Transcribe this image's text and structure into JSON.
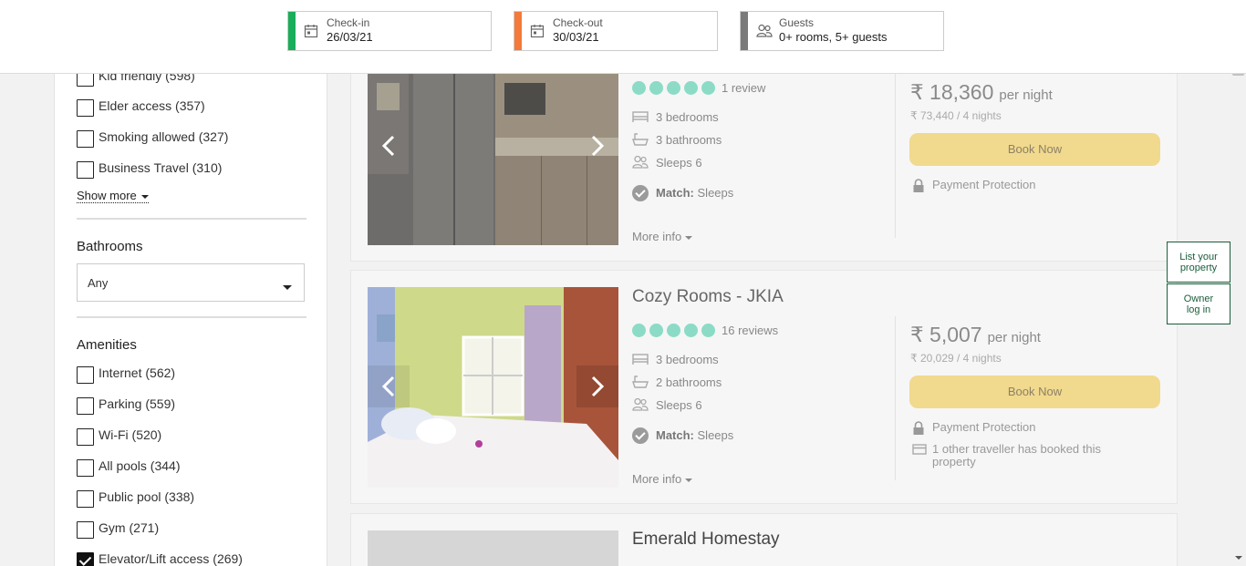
{
  "header": {
    "checkin": {
      "label": "Check-in",
      "value": "26/03/21",
      "color": "#1aae5a"
    },
    "checkout": {
      "label": "Check-out",
      "value": "30/03/21",
      "color": "#f47a3a"
    },
    "guests": {
      "label": "Guests",
      "value": "0+ rooms, 5+ guests",
      "color": "#7a7a7a"
    }
  },
  "sidebar": {
    "suitability": [
      {
        "label": "Kid friendly (598)",
        "checked": false
      },
      {
        "label": "Elder access (357)",
        "checked": false
      },
      {
        "label": "Smoking allowed (327)",
        "checked": false
      },
      {
        "label": "Business Travel (310)",
        "checked": false
      }
    ],
    "show_more": "Show more",
    "bathrooms_title": "Bathrooms",
    "bathrooms_value": "Any",
    "amenities_title": "Amenities",
    "amenities": [
      {
        "label": "Internet (562)",
        "checked": false
      },
      {
        "label": "Parking (559)",
        "checked": false
      },
      {
        "label": "Wi-Fi (520)",
        "checked": false
      },
      {
        "label": "All pools (344)",
        "checked": false
      },
      {
        "label": "Public pool (338)",
        "checked": false
      },
      {
        "label": "Gym (271)",
        "checked": false
      },
      {
        "label": "Elevator/Lift access (269)",
        "checked": true
      }
    ]
  },
  "listings": [
    {
      "title": "",
      "rating": 5,
      "reviews": "1 review",
      "bedrooms": "3 bedrooms",
      "bathrooms": "3 bathrooms",
      "sleeps": "Sleeps 6",
      "match_label": "Match:",
      "match_value": "Sleeps",
      "more_info": "More info",
      "price": "₹ 18,360",
      "per_night": "per night",
      "total": "₹ 73,440 / 4 nights",
      "book": "Book Now",
      "notes": [
        "Payment Protection"
      ]
    },
    {
      "title": "Cozy Rooms - JKIA",
      "rating": 5,
      "reviews": "16 reviews",
      "bedrooms": "3 bedrooms",
      "bathrooms": "2 bathrooms",
      "sleeps": "Sleeps 6",
      "match_label": "Match:",
      "match_value": "Sleeps",
      "more_info": "More info",
      "price": "₹ 5,007",
      "per_night": "per night",
      "total": "₹ 20,029 / 4 nights",
      "book": "Book Now",
      "notes": [
        "Payment Protection",
        "1 other traveller has booked this property"
      ]
    },
    {
      "title": "Emerald Homestay"
    }
  ],
  "floating": {
    "list_property": "List your property",
    "owner_login": "Owner log in"
  }
}
